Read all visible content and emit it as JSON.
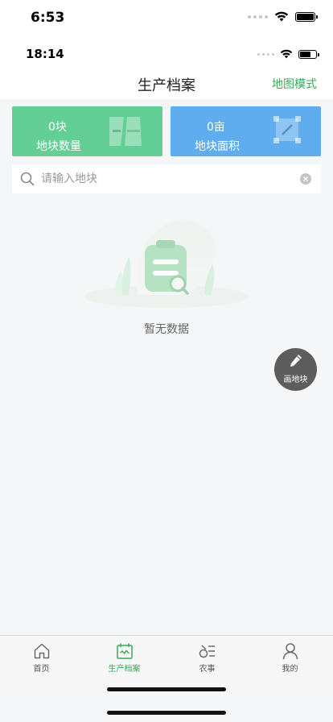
{
  "status_outer": {
    "time": "6:53"
  },
  "status_inner": {
    "time": "18:14"
  },
  "header": {
    "title": "生产档案",
    "map_mode": "地图模式"
  },
  "stats": {
    "plots": {
      "value": "0块",
      "label": "地块数量"
    },
    "area": {
      "value": "0亩",
      "label": "地块面积"
    }
  },
  "search": {
    "value": "",
    "placeholder": "请输入地块"
  },
  "empty": {
    "text": "暂无数据"
  },
  "fab": {
    "label": "画地块"
  },
  "tabs": [
    {
      "label": "首页",
      "icon": "home-icon",
      "active": false
    },
    {
      "label": "生产档案",
      "icon": "calendar-icon",
      "active": true
    },
    {
      "label": "农事",
      "icon": "farm-work-icon",
      "active": false
    },
    {
      "label": "我的",
      "icon": "user-icon",
      "active": false
    }
  ],
  "colors": {
    "accent": "#3aa85a",
    "plots_card": "#63cf96",
    "area_card": "#5fadee",
    "fab": "#5d5d5d"
  }
}
